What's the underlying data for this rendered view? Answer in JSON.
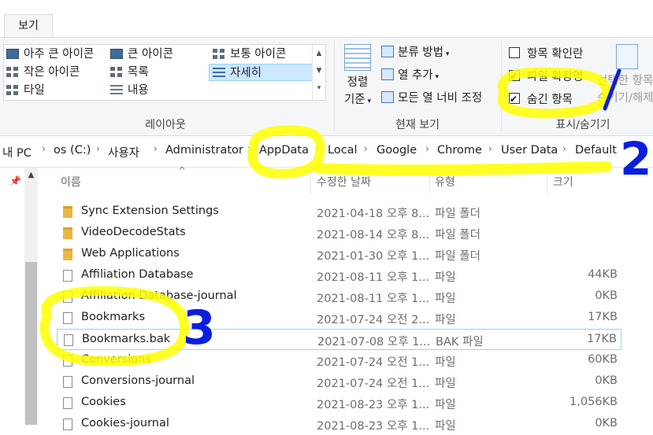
{
  "ribbon": {
    "tab_view": "보기",
    "layout": {
      "items": [
        {
          "label": "아주 큰 아이콘",
          "icon": "extra-large-icons-icon"
        },
        {
          "label": "큰 아이콘",
          "icon": "large-icons-icon"
        },
        {
          "label": "보통 아이콘",
          "icon": "medium-icons-icon"
        },
        {
          "label": "작은 아이콘",
          "icon": "small-icons-icon"
        },
        {
          "label": "목록",
          "icon": "list-icon"
        },
        {
          "label": "자세히",
          "icon": "details-icon",
          "selected": true
        },
        {
          "label": "타일",
          "icon": "tiles-icon"
        },
        {
          "label": "내용",
          "icon": "content-icon"
        }
      ],
      "group_label": "레이아웃"
    },
    "current_view": {
      "sort_label_1": "정렬",
      "sort_label_2": "기준",
      "group_by": "분류 방법",
      "add_columns": "열 추가",
      "size_all_columns": "모든 열 너비 조정",
      "group_label": "현재 보기"
    },
    "show_hide": {
      "item_check_boxes": {
        "label": "항목 확인란",
        "checked": false
      },
      "file_name_extensions": {
        "label": "파일 확장명",
        "checked": true
      },
      "hidden_items": {
        "label": "숨긴 항목",
        "checked": true
      },
      "hide_selected_1": "선택한 항목",
      "hide_selected_2": "숨기기/해제",
      "group_label": "표시/숨기기"
    }
  },
  "breadcrumb": [
    "내 PC",
    "os (C:)",
    "사용자",
    "Administrator",
    "AppData",
    "Local",
    "Google",
    "Chrome",
    "User Data",
    "Default"
  ],
  "columns": {
    "name": "이름",
    "date": "수정한 날짜",
    "type": "유형",
    "size": "크기"
  },
  "files": [
    {
      "name": "Sync Extension Settings",
      "date": "2021-04-18 오후 8...",
      "type": "파일 폴더",
      "size": "",
      "kind": "folder"
    },
    {
      "name": "VideoDecodeStats",
      "date": "2021-08-14 오후 8...",
      "type": "파일 폴더",
      "size": "",
      "kind": "folder"
    },
    {
      "name": "Web Applications",
      "date": "2021-01-30 오후 1...",
      "type": "파일 폴더",
      "size": "",
      "kind": "folder"
    },
    {
      "name": "Affiliation Database",
      "date": "2021-08-11 오후 1...",
      "type": "파일",
      "size": "44KB",
      "kind": "file"
    },
    {
      "name": "Affiliation Database-journal",
      "date": "2021-08-11 오후 1...",
      "type": "파일",
      "size": "0KB",
      "kind": "file"
    },
    {
      "name": "Bookmarks",
      "date": "2021-07-24 오전 2...",
      "type": "파일",
      "size": "17KB",
      "kind": "file"
    },
    {
      "name": "Bookmarks.bak",
      "date": "2021-07-08 오후 1...",
      "type": "BAK 파일",
      "size": "17KB",
      "kind": "file",
      "focused": true
    },
    {
      "name": "Conversions",
      "date": "2021-07-24 오전 1...",
      "type": "파일",
      "size": "60KB",
      "kind": "file"
    },
    {
      "name": "Conversions-journal",
      "date": "2021-07-24 오전 1...",
      "type": "파일",
      "size": "0KB",
      "kind": "file"
    },
    {
      "name": "Cookies",
      "date": "2021-08-23 오후 1...",
      "type": "파일",
      "size": "1,056KB",
      "kind": "file"
    },
    {
      "name": "Cookies-journal",
      "date": "2021-08-23 오후 1...",
      "type": "파일",
      "size": "0KB",
      "kind": "file"
    }
  ],
  "annotations": [
    "1",
    "2",
    "3"
  ],
  "colors": {
    "highlight": "#ffff00",
    "annotation_ink": "#0a1ee0",
    "selection": "#cce8ff"
  }
}
